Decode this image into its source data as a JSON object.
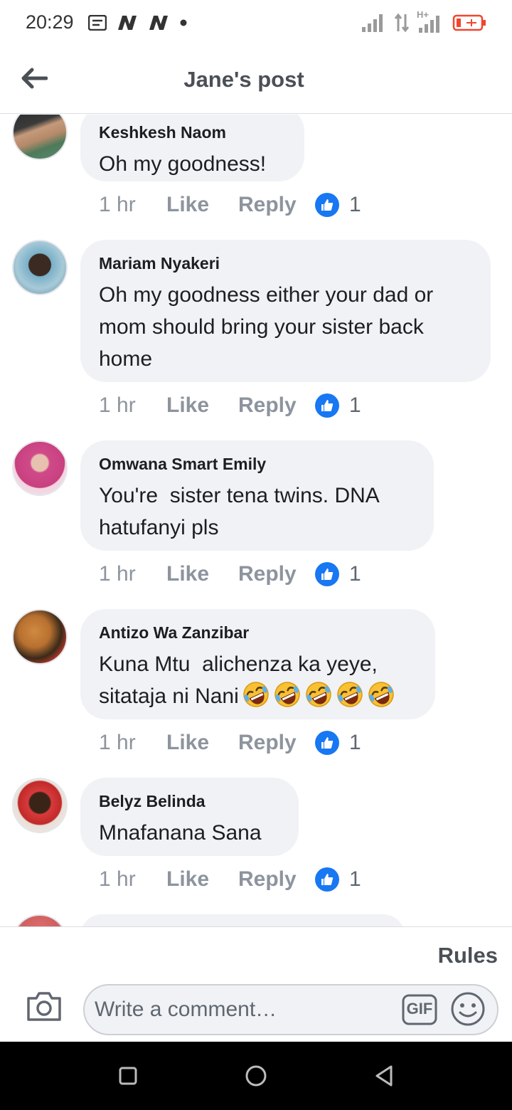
{
  "status_bar": {
    "time": "20:29",
    "network_label": "H+"
  },
  "header": {
    "title": "Jane's post",
    "back_icon": "arrow-left-icon"
  },
  "comments": [
    {
      "author": "Keshkesh Naom",
      "text": "Oh my goodness!",
      "time": "1 hr",
      "like_label": "Like",
      "reply_label": "Reply",
      "like_count": "1"
    },
    {
      "author": "Mariam Nyakeri",
      "text": "Oh my goodness either your dad or mom should bring your sister back home",
      "time": "1 hr",
      "like_label": "Like",
      "reply_label": "Reply",
      "like_count": "1"
    },
    {
      "author": "Omwana Smart Emily",
      "text": "You're  sister tena twins. DNA hatufanyi pls",
      "time": "1 hr",
      "like_label": "Like",
      "reply_label": "Reply",
      "like_count": "1"
    },
    {
      "author": "Antizo Wa Zanzibar",
      "text": "Kuna Mtu  alichenza ka yeye, sitataja ni Nani",
      "time": "1 hr",
      "like_label": "Like",
      "reply_label": "Reply",
      "like_count": "1",
      "emoji_count": 5
    },
    {
      "author": "Belyz Belinda",
      "text": "Mnafanana Sana",
      "time": "1 hr",
      "like_label": "Like",
      "reply_label": "Reply",
      "like_count": "1"
    }
  ],
  "composer": {
    "rules_label": "Rules",
    "placeholder": "Write a comment…",
    "gif_label": "GIF",
    "camera_icon": "camera-icon",
    "emoji_icon": "smiley-icon"
  },
  "colors": {
    "like_blue": "#1877f2",
    "bubble_bg": "#f0f2f5",
    "meta_gray": "#8d949e",
    "battery_red": "#f0462e"
  }
}
